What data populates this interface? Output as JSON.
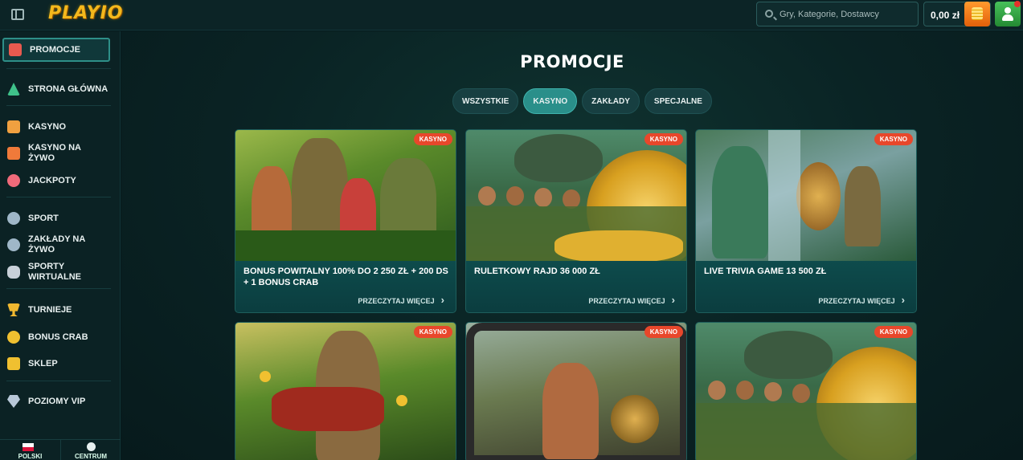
{
  "app": {
    "logo": "PLAYIO"
  },
  "header": {
    "search_placeholder": "Gry, Kategorie, Dostawcy",
    "balance": "0,00 zł"
  },
  "sidebar": {
    "items": [
      {
        "label": "Promocje",
        "icon": "gift-icon",
        "color": "#e85a4f",
        "active": true
      },
      {
        "label": "Strona Główna",
        "icon": "home-icon",
        "color": "#3fc28a"
      },
      {
        "label": "Kasyno",
        "icon": "casino-chest-icon",
        "color": "#f0a040"
      },
      {
        "label": "Kasyno na żywo",
        "icon": "live-cards-icon",
        "color": "#f07a3a"
      },
      {
        "label": "Jackpoty",
        "icon": "jackpot-clover-icon",
        "color": "#f06a7a"
      },
      {
        "label": "Sport",
        "icon": "ball-icon",
        "color": "#9fb7c8"
      },
      {
        "label": "Zakłady na żywo",
        "icon": "live-sport-icon",
        "color": "#9fb7c8"
      },
      {
        "label": "Sporty wirtualne",
        "icon": "gamepad-icon",
        "color": "#c8d0d8"
      },
      {
        "label": "Turnieje",
        "icon": "trophy-icon",
        "color": "#f0b830"
      },
      {
        "label": "Bonus Crab",
        "icon": "crab-coin-icon",
        "color": "#f0c030"
      },
      {
        "label": "Sklep",
        "icon": "shop-bag-icon",
        "color": "#f0c030"
      },
      {
        "label": "Poziomy VIP",
        "icon": "diamond-icon",
        "color": "#b8c8d8"
      }
    ],
    "bottom": {
      "language": "POLSKI",
      "help": "CENTRUM"
    }
  },
  "main": {
    "title": "PROMOCJE",
    "tabs": [
      {
        "label": "Wszystkie",
        "active": false
      },
      {
        "label": "Kasyno",
        "active": true
      },
      {
        "label": "Zakłady",
        "active": false
      },
      {
        "label": "Specjalne",
        "active": false
      }
    ],
    "cards": [
      {
        "badge": "Kasyno",
        "title": "Bonus powitalny 100% do 2 250 zł + 200 DS + 1 Bonus Crab",
        "more": "Przeczytaj więcej"
      },
      {
        "badge": "Kasyno",
        "title": "Ruletkowy Rajd 36 000 zł",
        "more": "Przeczytaj więcej"
      },
      {
        "badge": "Kasyno",
        "title": "Live Trivia Game 13 500 zł",
        "more": "Przeczytaj więcej"
      },
      {
        "badge": "Kasyno",
        "title": "",
        "more": ""
      },
      {
        "badge": "Kasyno",
        "title": "",
        "more": ""
      },
      {
        "badge": "Kasyno",
        "title": "",
        "more": ""
      }
    ]
  }
}
